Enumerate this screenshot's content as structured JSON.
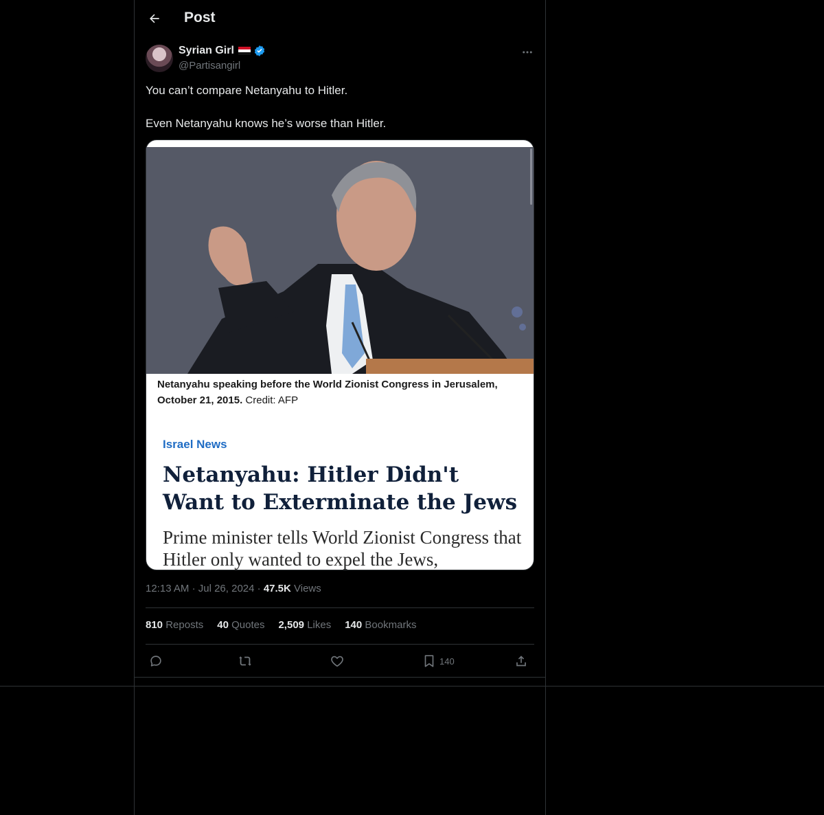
{
  "header": {
    "title": "Post"
  },
  "author": {
    "display_name": "Syrian Girl",
    "handle": "@Partisangirl"
  },
  "tweet": {
    "line1": "You can’t compare Netanyahu to Hitler.",
    "line2": "Even Netanyahu knows he’s worse than Hitler."
  },
  "media": {
    "caption_bold": "Netanyahu speaking before the World Zionist Congress in Jerusalem, October 21, 2015.",
    "caption_credit": "Credit: AFP",
    "section": "Israel News",
    "headline": "Netanyahu: Hitler Didn't Want to Exterminate the Jews",
    "subhead": "Prime minister tells World Zionist Congress that Hitler only wanted to expel the Jews,"
  },
  "meta": {
    "time": "12:13 AM",
    "date": "Jul 26, 2024",
    "views_count": "47.5K",
    "views_label": "Views"
  },
  "stats": {
    "reposts_count": "810",
    "reposts_label": "Reposts",
    "quotes_count": "40",
    "quotes_label": "Quotes",
    "likes_count": "2,509",
    "likes_label": "Likes",
    "bookmarks_count": "140",
    "bookmarks_label": "Bookmarks"
  },
  "actions": {
    "bookmark_count": "140"
  },
  "colors": {
    "background": "#000000",
    "text": "#e7e9ea",
    "muted": "#71767b",
    "border": "#2f3336",
    "verified": "#1d9bf0"
  },
  "icons": [
    "back-arrow-icon",
    "verified-icon",
    "syria-flag-icon",
    "more-icon",
    "reply-icon",
    "repost-icon",
    "like-icon",
    "bookmark-icon",
    "share-icon"
  ]
}
